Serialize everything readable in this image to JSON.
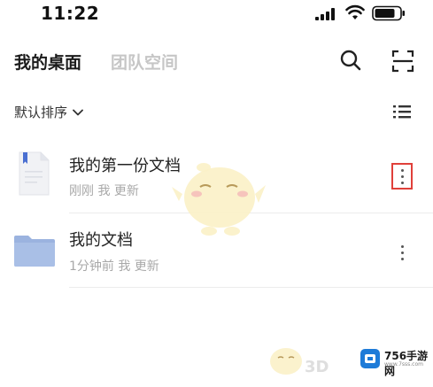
{
  "status_bar": {
    "time": "11:22",
    "icons": [
      "signal-icon",
      "wifi-icon",
      "battery-icon"
    ]
  },
  "header": {
    "tabs": [
      {
        "label": "我的桌面",
        "active": true
      },
      {
        "label": "团队空间",
        "active": false
      }
    ],
    "actions": [
      "search-icon",
      "scan-icon"
    ]
  },
  "toolbar": {
    "sort_label": "默认排序",
    "sort_icon": "chevron-down-icon",
    "view_icon": "list-view-icon"
  },
  "files": [
    {
      "title": "我的第一份文档",
      "meta": "刚刚 我 更新",
      "type": "document",
      "icon": "document-icon",
      "menu_highlighted": true
    },
    {
      "title": "我的文档",
      "meta": "1分钟前 我 更新",
      "type": "folder",
      "icon": "folder-icon",
      "menu_highlighted": false
    }
  ],
  "watermark": {
    "text": "3D",
    "brand_name": "756手游网",
    "brand_url": "www.7sss.com"
  },
  "colors": {
    "active_tab": "#1b1b1b",
    "inactive_tab": "#c6c6c6",
    "meta_text": "#a8a8a8",
    "highlight_border": "#e0403a",
    "folder": "#9bb3df",
    "brand_blue": "#1e7bd8"
  }
}
